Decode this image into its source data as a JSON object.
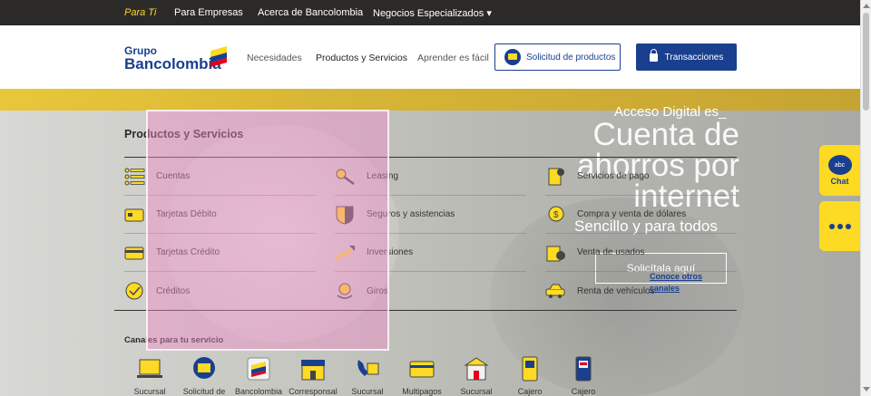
{
  "topbar": {
    "items": [
      {
        "label": "Para Ti",
        "active": true
      },
      {
        "label": "Para Empresas"
      },
      {
        "label": "Acerca de Bancolombia"
      },
      {
        "label": "Negocios Especializados ▾"
      }
    ]
  },
  "header": {
    "logo_line1": "Grupo",
    "logo_line2": "Bancolombia",
    "nav": [
      {
        "label": "Necesidades"
      },
      {
        "label": "Productos y Servicios",
        "active": true
      },
      {
        "label": "Aprender es fácil"
      }
    ],
    "solicitud_label": "Solicitud de productos",
    "transacciones_label": "Transacciones"
  },
  "menu": {
    "title": "Productos y Servicios",
    "items": [
      {
        "label": "Cuentas",
        "icon": "list-icon"
      },
      {
        "label": "Leasing",
        "icon": "key-icon"
      },
      {
        "label": "Servicios de pago",
        "icon": "bill-payment-icon"
      },
      {
        "label": "Tarjetas Débito",
        "icon": "debit-card-icon"
      },
      {
        "label": "Seguros y asistencias",
        "icon": "shield-icon"
      },
      {
        "label": "Compra y venta de dólares",
        "icon": "dollar-exchange-icon"
      },
      {
        "label": "Tarjetas Crédito",
        "icon": "credit-card-icon"
      },
      {
        "label": "Inversiones",
        "icon": "growth-chart-icon"
      },
      {
        "label": "Venta de usados",
        "icon": "used-sale-icon"
      },
      {
        "label": "Créditos",
        "icon": "check-circle-icon"
      },
      {
        "label": "Giros",
        "icon": "money-transfer-icon"
      },
      {
        "label": "Renta de vehículos",
        "icon": "car-rental-icon"
      }
    ]
  },
  "canales": {
    "title": "Canales para tu servicio",
    "items": [
      {
        "label": "Sucursal",
        "icon": "laptop-icon"
      },
      {
        "label": "Solicitud de",
        "icon": "request-icon"
      },
      {
        "label": "Bancolombia",
        "icon": "bancolombia-app-icon"
      },
      {
        "label": "Corresponsal",
        "icon": "store-icon"
      },
      {
        "label": "Sucursal",
        "icon": "phone-branch-icon"
      },
      {
        "label": "Multipagos",
        "icon": "multipay-card-icon"
      },
      {
        "label": "Sucursal",
        "icon": "building-icon"
      },
      {
        "label": "Cajero",
        "icon": "atm-icon"
      },
      {
        "label": "Cajero",
        "icon": "atm-deposit-icon"
      }
    ]
  },
  "hero": {
    "eyebrow": "Acceso Digital es_",
    "headline": "Cuenta de ahorros por internet",
    "subline": "Sencillo y para todos",
    "cta": "Solicítala aquí",
    "link": "Conoce otros canales"
  },
  "side": {
    "chat_badge": "abc",
    "chat_label": "Chat"
  },
  "colors": {
    "brand_blue": "#1a3f8f",
    "brand_yellow": "#fdda24",
    "topbar_bg": "#2c2a29"
  }
}
